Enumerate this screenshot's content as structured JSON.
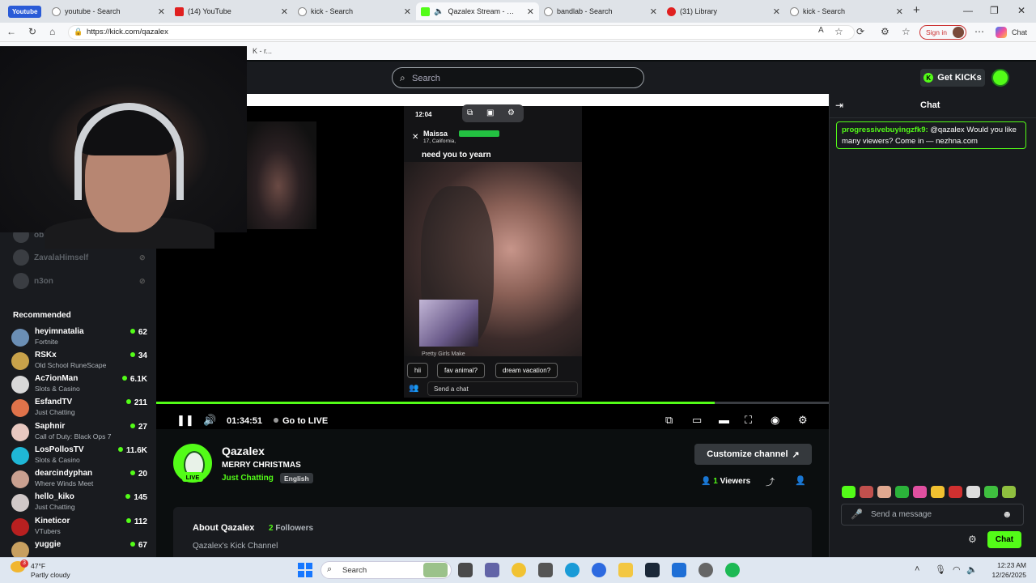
{
  "browser": {
    "tabs": [
      {
        "label": "youtube - Search"
      },
      {
        "label": "(14) YouTube"
      },
      {
        "label": "kick - Search"
      },
      {
        "label": "Qazalex Stream - Watc"
      },
      {
        "label": "bandlab - Search"
      },
      {
        "label": "(31) Library"
      },
      {
        "label": "kick - Search"
      }
    ],
    "youtube_pill": "Youtube",
    "url": "https://kick.com/qazalex",
    "sign_in": "Sign in",
    "chat_label": "Chat",
    "favorites_text": "K - r..."
  },
  "site": {
    "search_placeholder": "Search",
    "get_kicks": "Get KICKs"
  },
  "sidebar": {
    "offline": [
      {
        "name": "oblivionsw"
      },
      {
        "name": "ZavalaHimself"
      },
      {
        "name": "n3on"
      }
    ],
    "recommended_title": "Recommended",
    "recommended": [
      {
        "name": "heyimnatalia",
        "category": "Fortnite",
        "viewers": "62",
        "color": "#6b8fb5"
      },
      {
        "name": "RSKx",
        "category": "Old School RuneScape",
        "viewers": "34",
        "color": "#c8a24a"
      },
      {
        "name": "Ac7ionMan",
        "category": "Slots & Casino",
        "viewers": "6.1K",
        "color": "#d8d8d8"
      },
      {
        "name": "EsfandTV",
        "category": "Just Chatting",
        "viewers": "211",
        "color": "#e0734a"
      },
      {
        "name": "Saphnir",
        "category": "Call of Duty: Black Ops 7",
        "viewers": "27",
        "color": "#e8c8c0"
      },
      {
        "name": "LosPollosTV",
        "category": "Slots & Casino",
        "viewers": "11.6K",
        "color": "#1fb7d6"
      },
      {
        "name": "dearcindyphan",
        "category": "Where Winds Meet",
        "viewers": "20",
        "color": "#c9a090"
      },
      {
        "name": "hello_kiko",
        "category": "Just Chatting",
        "viewers": "145",
        "color": "#d0c8c8"
      },
      {
        "name": "Kineticor",
        "category": "VTubers",
        "viewers": "112",
        "color": "#b82020"
      },
      {
        "name": "yuggie",
        "category": "",
        "viewers": "67",
        "color": "#c8a060"
      }
    ]
  },
  "video": {
    "phone_time": "12:04",
    "phone_user": "Maissa",
    "phone_sub": "17, California,",
    "phone_caption": "need you to yearn",
    "thumb_caption": "Pretty Girls Make",
    "quick_chips": [
      "hii",
      "fav animal?",
      "dream vacation?"
    ],
    "send_chat": "Send a chat",
    "elapsed": "01:34:51",
    "go_live": "Go to LIVE",
    "progress": 0.83
  },
  "channel": {
    "name": "Qazalex",
    "title": "MERRY CHRISTMAS",
    "category": "Just Chatting",
    "language": "English",
    "live_badge": "LIVE",
    "customize": "Customize channel",
    "viewers_count": "1",
    "viewers_label": "Viewers",
    "about_title": "About Qazalex",
    "followers_count": "2",
    "followers_label": "Followers",
    "about_desc": "Qazalex's Kick Channel"
  },
  "chat": {
    "title": "Chat",
    "messages": [
      {
        "user": "progressivebuyingzfk9:",
        "text": "@qazalex Would you like many viewers? Come in — nezhna.com"
      }
    ],
    "placeholder": "Send a message",
    "send_label": "Chat"
  },
  "taskbar": {
    "temp": "47°F",
    "weather": "Partly cloudy",
    "weather_badge": "3",
    "search": "Search",
    "time": "12:23 AM",
    "date": "12/26/2025"
  },
  "colors": {
    "kick_green": "#53fc18",
    "bg": "#0b0e0f",
    "panel": "#191b1f"
  }
}
